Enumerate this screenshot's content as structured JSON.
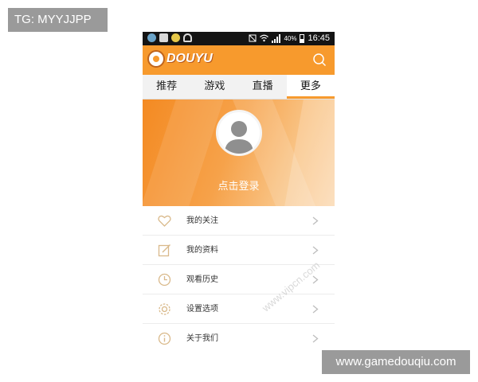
{
  "overlay": {
    "tg_label": "TG: MYYJJPP",
    "site_label": "www.gamedouqiu.com"
  },
  "status_bar": {
    "time": "16:45",
    "battery": "40%"
  },
  "header": {
    "logo_text": "DOUYU"
  },
  "tabs": [
    {
      "label": "推荐"
    },
    {
      "label": "游戏"
    },
    {
      "label": "直播"
    },
    {
      "label": "更多"
    }
  ],
  "banner": {
    "login_label": "点击登录"
  },
  "menu": [
    {
      "label": "我的关注",
      "icon": "heart-icon"
    },
    {
      "label": "我的资料",
      "icon": "edit-icon"
    },
    {
      "label": "观看历史",
      "icon": "clock-icon"
    },
    {
      "label": "设置选项",
      "icon": "gear-icon"
    },
    {
      "label": "关于我们",
      "icon": "info-icon"
    }
  ],
  "watermark": "www.vipcn.com",
  "colors": {
    "accent": "#f79a2d",
    "icon": "#d9b98a"
  }
}
